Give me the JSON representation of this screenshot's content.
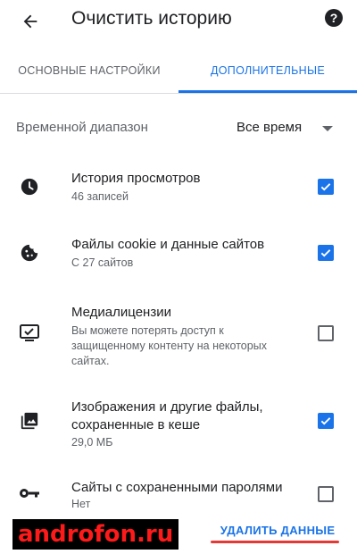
{
  "appbar": {
    "title": "Очистить историю",
    "back_icon": "arrow-back-icon",
    "help_icon": "help-icon",
    "help_glyph": "?"
  },
  "tabs": [
    {
      "label": "ОСНОВНЫЕ НАСТРОЙКИ",
      "selected": false
    },
    {
      "label": "ДОПОЛНИТЕЛЬНЫЕ",
      "selected": true
    }
  ],
  "time_range": {
    "label": "Временной диапазон",
    "value": "Все время"
  },
  "items": [
    {
      "icon": "clock-icon",
      "title": "История просмотров",
      "subtitle": "46 записей",
      "checked": true
    },
    {
      "icon": "cookie-icon",
      "title": "Файлы cookie и данные сайтов",
      "subtitle": "С 27 сайтов",
      "checked": true
    },
    {
      "icon": "monitor-license-icon",
      "title": "Медиалицензии",
      "subtitle": "Вы можете потерять доступ к защищенному контенту на некоторых сайтах.",
      "checked": false
    },
    {
      "icon": "images-icon",
      "title": "Изображения и другие файлы, сохраненные в кеше",
      "subtitle": "29,0 МБ",
      "checked": true
    },
    {
      "icon": "key-icon",
      "title": "Сайты с сохраненными паролями",
      "subtitle": "Нет",
      "checked": false
    }
  ],
  "footer": {
    "delete_label": "УДАЛИТЬ ДАННЫЕ",
    "watermark": "androfon.ru"
  },
  "colors": {
    "accent": "#1a73e8",
    "text_primary": "#202124",
    "text_secondary": "#5f6368",
    "underline": "#e53935"
  }
}
